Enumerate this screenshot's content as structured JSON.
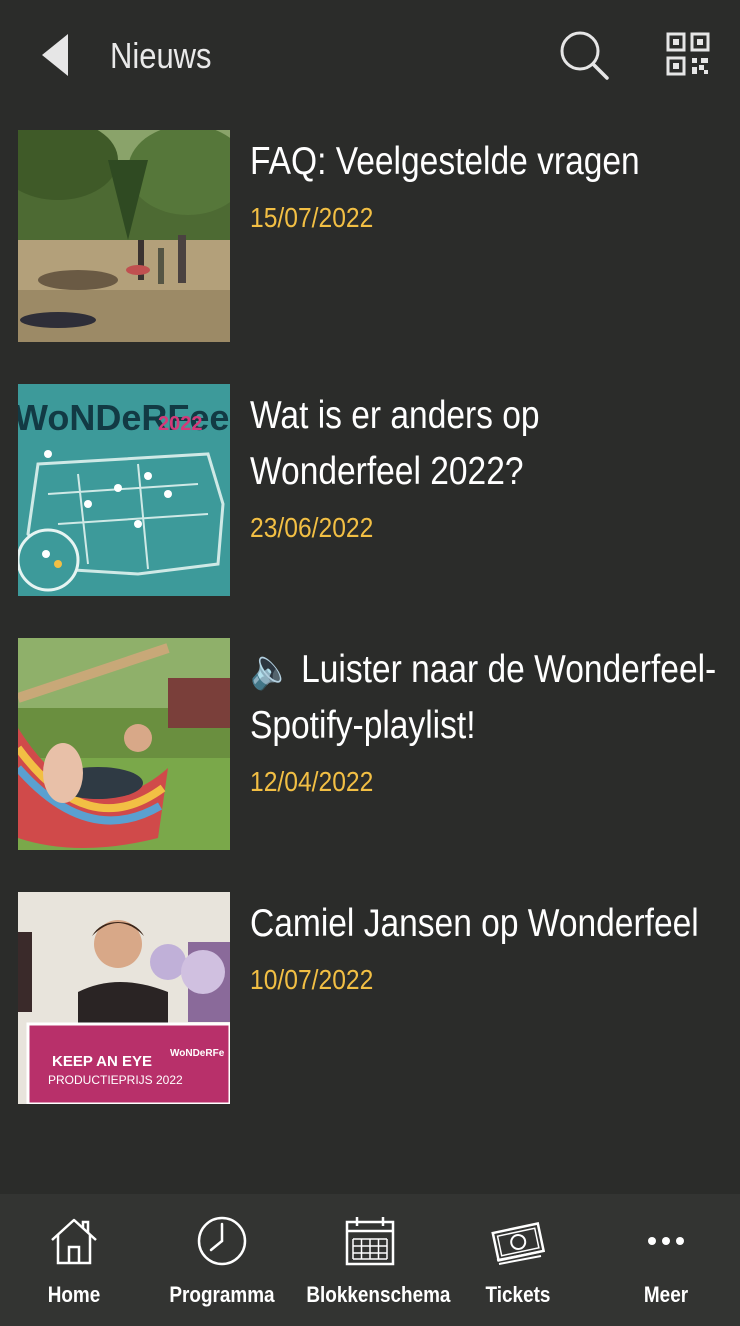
{
  "header": {
    "title": "Nieuws",
    "back_icon": "back-arrow-icon",
    "search_icon": "search-icon",
    "qr_icon": "qr-code-icon"
  },
  "news": [
    {
      "title": "FAQ: Veelgestelde vragen",
      "date": "15/07/2022",
      "image": "festival-crowd-in-forest"
    },
    {
      "title": "Wat is er anders op Wonderfeel 2022?",
      "date": "23/06/2022",
      "image": "festival-map-wonderfeel-2022"
    },
    {
      "title": "🔈 Luister naar de Wonderfeel-Spotify-playlist!",
      "date": "12/04/2022",
      "image": "man-in-hammock"
    },
    {
      "title": "Camiel Jansen op Wonderfeel",
      "date": "10/07/2022",
      "image": "man-with-award-sign"
    }
  ],
  "thumb_text": {
    "map_logo": "WoNDeRFeel",
    "map_year": "2022",
    "award_line1": "KEEP AN EYE",
    "award_line2": "PRODUCTIEPRIJS 2022",
    "award_brand": "WoNDeRFe"
  },
  "tabbar": [
    {
      "label": "Home",
      "icon": "home-icon"
    },
    {
      "label": "Programma",
      "icon": "clock-icon"
    },
    {
      "label": "Blokkenschema",
      "icon": "calendar-icon"
    },
    {
      "label": "Tickets",
      "icon": "ticket-icon"
    },
    {
      "label": "Meer",
      "icon": "more-dots-icon"
    }
  ],
  "colors": {
    "background": "#2b2c2a",
    "tabbar": "#333432",
    "date_accent": "#f2bf44",
    "text": "#ffffff"
  }
}
